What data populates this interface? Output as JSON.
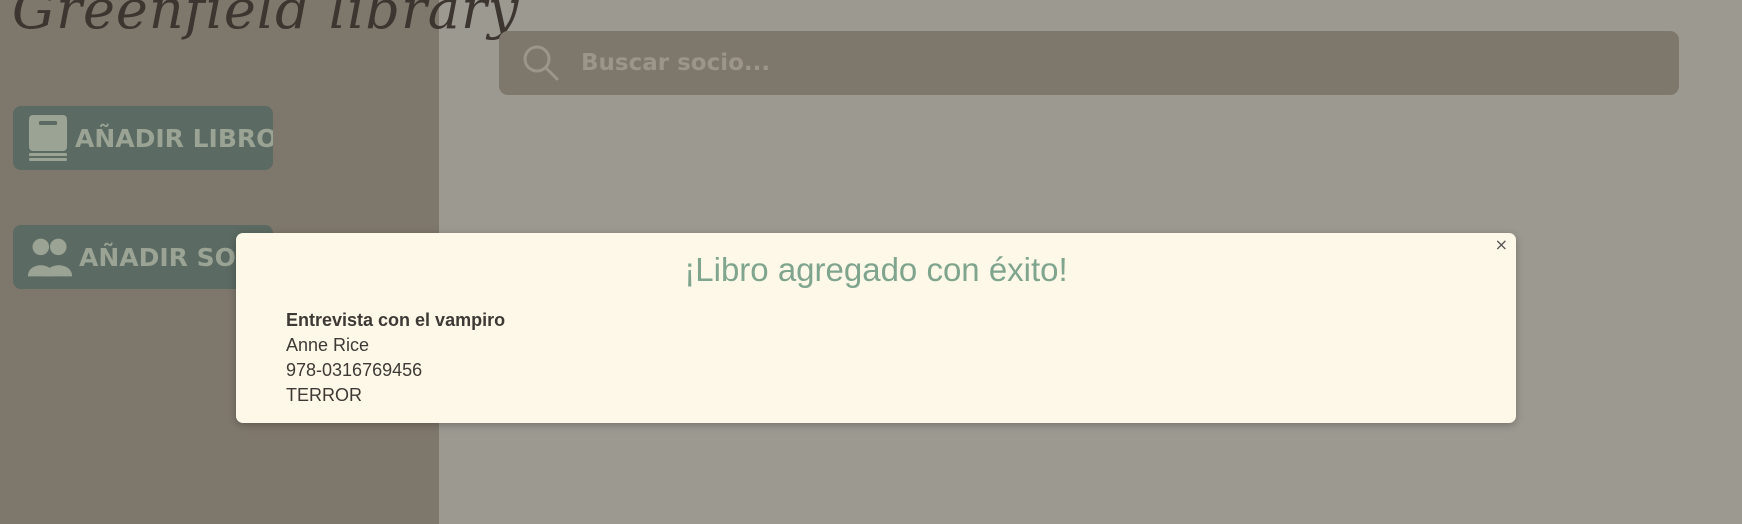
{
  "sidebar": {
    "brand": "Greenfield library",
    "add_book_label": "AÑADIR LIBRO",
    "add_member_label": "AÑADIR SOCIO"
  },
  "search": {
    "placeholder": "Buscar socio..."
  },
  "modal": {
    "title": "¡Libro agregado con éxito!",
    "close": "×",
    "book_title": "Entrevista con el vampiro",
    "author": "Anne Rice",
    "isbn": "978-0316769456",
    "genre": "TERROR"
  },
  "colors": {
    "sidebar_bg": "#7e776c",
    "main_bg": "#9c9990",
    "button_bg": "#5b6a62",
    "modal_bg": "#fef8e8",
    "accent_green": "#7fa58e"
  }
}
